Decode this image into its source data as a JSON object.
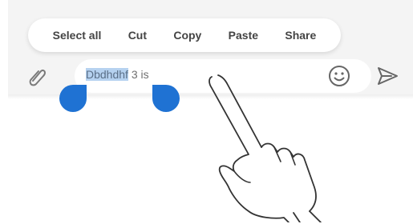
{
  "context_menu": {
    "items": [
      {
        "label": "Select all"
      },
      {
        "label": "Cut"
      },
      {
        "label": "Copy"
      },
      {
        "label": "Paste"
      },
      {
        "label": "Share"
      }
    ]
  },
  "composer": {
    "selected_text": "Dbdhdhf",
    "unselected_text": " 3 is",
    "icons": {
      "attach": "paperclip-icon",
      "emoji": "smiley-icon",
      "send": "send-icon"
    }
  },
  "colors": {
    "selection_highlight": "#b6d2f0",
    "handle": "#1f72d3",
    "composer_background": "#f4f4f4"
  }
}
